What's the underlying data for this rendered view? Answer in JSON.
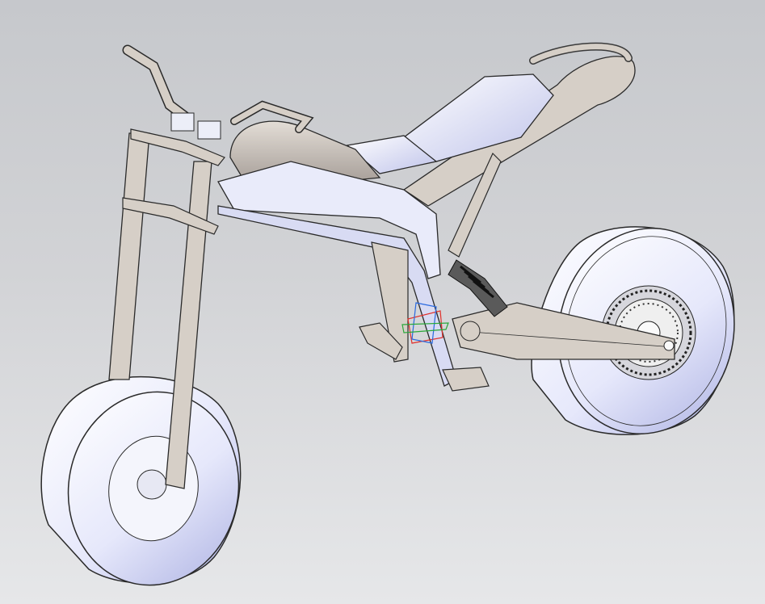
{
  "viewport": {
    "background_top": "#c6c8cc",
    "background_bottom": "#e6e7e9",
    "model_name": "",
    "parts": [
      "handlebar",
      "fork",
      "front-wheel",
      "rear-wheel",
      "brake-disc",
      "main-frame",
      "seat",
      "tank",
      "swingarm",
      "rear-shock",
      "footpeg",
      "coordinate-triad"
    ]
  },
  "colors": {
    "metal": "#d6cfc7",
    "wheel": "#eef0fb",
    "wheel_shade": "#c9cdef",
    "edge": "#2a2a2a",
    "triad_x": "#e0302a",
    "triad_y": "#2aa83a",
    "triad_z": "#2a6ae0"
  }
}
